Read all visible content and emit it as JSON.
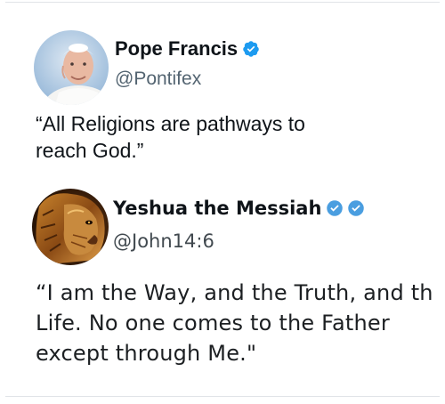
{
  "posts": [
    {
      "display_name": "Pope Francis",
      "handle": "@Pontifex",
      "verified_badges": [
        "verified-badge-icon"
      ],
      "avatar": "pope-avatar",
      "text": "“All Religions are pathways to\nreach God.”"
    },
    {
      "display_name": "Yeshua the Messiah",
      "handle": "@John14:6",
      "verified_badges": [
        "verified-badge-icon",
        "verified-badge-icon"
      ],
      "avatar": "lion-avatar",
      "text": "“I am the Way, and the Truth, and the\nLife. No one comes to the Father\nexcept through Me.\""
    }
  ],
  "colors": {
    "verified_badge": "#1d9bf0",
    "text": "#0f1419",
    "handle": "#536471",
    "divider": "#e1e4e8"
  }
}
